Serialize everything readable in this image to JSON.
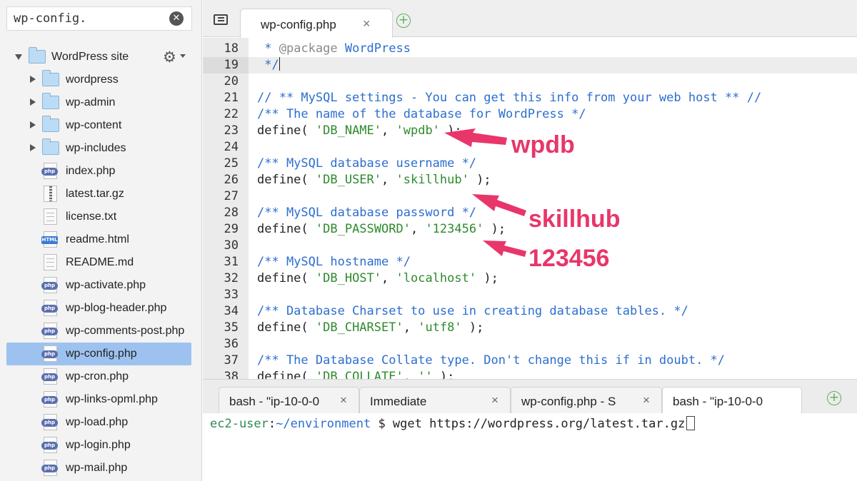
{
  "sidebar": {
    "search_value": "wp-config.",
    "root": {
      "label": "WordPress site",
      "icon": "folder-icon"
    },
    "items": [
      {
        "label": "wordpress",
        "type": "folder"
      },
      {
        "label": "wp-admin",
        "type": "folder"
      },
      {
        "label": "wp-content",
        "type": "folder"
      },
      {
        "label": "wp-includes",
        "type": "folder"
      },
      {
        "label": "index.php",
        "type": "php"
      },
      {
        "label": "latest.tar.gz",
        "type": "zip"
      },
      {
        "label": "license.txt",
        "type": "text"
      },
      {
        "label": "readme.html",
        "type": "html"
      },
      {
        "label": "README.md",
        "type": "text"
      },
      {
        "label": "wp-activate.php",
        "type": "php"
      },
      {
        "label": "wp-blog-header.php",
        "type": "php"
      },
      {
        "label": "wp-comments-post.php",
        "type": "php"
      },
      {
        "label": "wp-config.php",
        "type": "php",
        "selected": true
      },
      {
        "label": "wp-cron.php",
        "type": "php"
      },
      {
        "label": "wp-links-opml.php",
        "type": "php"
      },
      {
        "label": "wp-load.php",
        "type": "php"
      },
      {
        "label": "wp-login.php",
        "type": "php"
      },
      {
        "label": "wp-mail.php",
        "type": "php"
      }
    ],
    "badges": {
      "php": "php",
      "html": "HTML"
    }
  },
  "editor": {
    "tab_label": "wp-config.php",
    "close_glyph": "×",
    "add_glyph": "+",
    "lines": [
      {
        "n": "18",
        "text": " * @package WordPress"
      },
      {
        "n": "19",
        "text": " */"
      },
      {
        "n": "20",
        "text": ""
      },
      {
        "n": "21",
        "text": "// ** MySQL settings - You can get this info from your web host ** //"
      },
      {
        "n": "22",
        "text": "/** The name of the database for WordPress */"
      },
      {
        "n": "23",
        "text": "define( 'DB_NAME', 'wpdb' );"
      },
      {
        "n": "24",
        "text": ""
      },
      {
        "n": "25",
        "text": "/** MySQL database username */"
      },
      {
        "n": "26",
        "text": "define( 'DB_USER', 'skillhub' );"
      },
      {
        "n": "27",
        "text": ""
      },
      {
        "n": "28",
        "text": "/** MySQL database password */"
      },
      {
        "n": "29",
        "text": "define( 'DB_PASSWORD', '123456' );"
      },
      {
        "n": "30",
        "text": ""
      },
      {
        "n": "31",
        "text": "/** MySQL hostname */"
      },
      {
        "n": "32",
        "text": "define( 'DB_HOST', 'localhost' );"
      },
      {
        "n": "33",
        "text": ""
      },
      {
        "n": "34",
        "text": "/** Database Charset to use in creating database tables. */"
      },
      {
        "n": "35",
        "text": "define( 'DB_CHARSET', 'utf8' );"
      },
      {
        "n": "36",
        "text": ""
      },
      {
        "n": "37",
        "text": "/** The Database Collate type. Don't change this if in doubt. */"
      },
      {
        "n": "38",
        "text": "define( 'DB_COLLATE', '' );"
      }
    ]
  },
  "annotations": {
    "db_name": "wpdb",
    "db_user": "skillhub",
    "db_password": "123456",
    "color": "#e8366a"
  },
  "terminal": {
    "tabs": [
      {
        "label": "bash - \"ip-10-0-0"
      },
      {
        "label": "Immediate"
      },
      {
        "label": "wp-config.php - S"
      },
      {
        "label": "bash - \"ip-10-0-0"
      }
    ],
    "prompt_user": "ec2-user",
    "prompt_sep": ":",
    "prompt_path": "~/environment",
    "prompt_symbol": " $ ",
    "command": "wget https://wordpress.org/latest.tar.gz"
  },
  "colors": {
    "selection": "#9ec2f0",
    "comment": "#2d6ecf",
    "string": "#2e8b2e",
    "add_button": "#5fae5f"
  }
}
